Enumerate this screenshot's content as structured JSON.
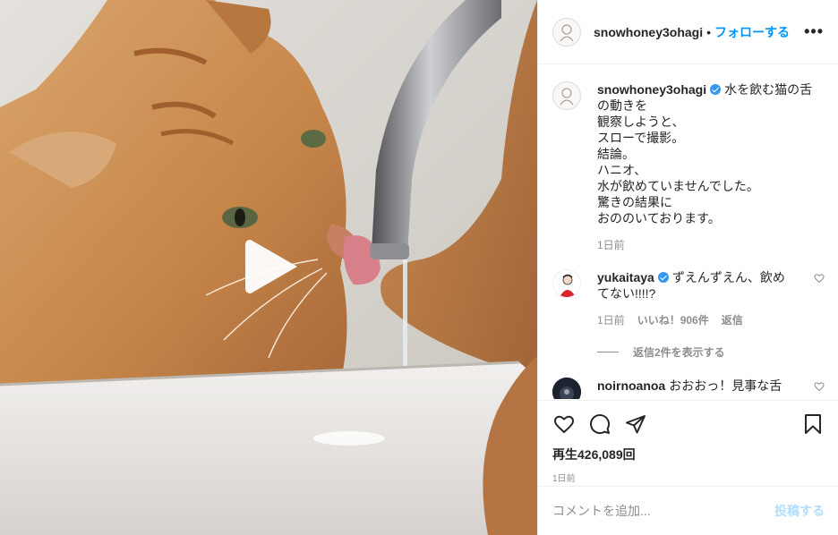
{
  "media": {
    "play_icon": "play-icon"
  },
  "header": {
    "username": "snowhoney3ohagi",
    "separator": "•",
    "follow_label": "フォローする",
    "more_label": "•••"
  },
  "caption": {
    "username": "snowhoney3ohagi",
    "lines": [
      "水を飲む猫の舌",
      "の動きを",
      "観察しようと、",
      "スローで撮影。",
      "結論。",
      "ハニオ、",
      "水が飲めていませんでした。",
      "驚きの結果に",
      "おののいております。"
    ],
    "time": "1日前"
  },
  "comments": [
    {
      "username": "yukaitaya",
      "text_line1": "ずえんずえん、飲め",
      "text_line2": "てない!!!!?",
      "time": "1日前",
      "likes": "いいね！906件",
      "reply_label": "返信",
      "view_replies": "返信2件を表示する"
    },
    {
      "username": "noirnoanoa",
      "text": "おおおっ！見事な舌"
    }
  ],
  "actions": {
    "like_icon": "heart-icon",
    "comment_icon": "comment-icon",
    "share_icon": "share-icon",
    "save_icon": "bookmark-icon",
    "views": "再生426,089回",
    "date": "1日前"
  },
  "add_comment": {
    "placeholder": "コメントを追加...",
    "post_label": "投稿する"
  }
}
